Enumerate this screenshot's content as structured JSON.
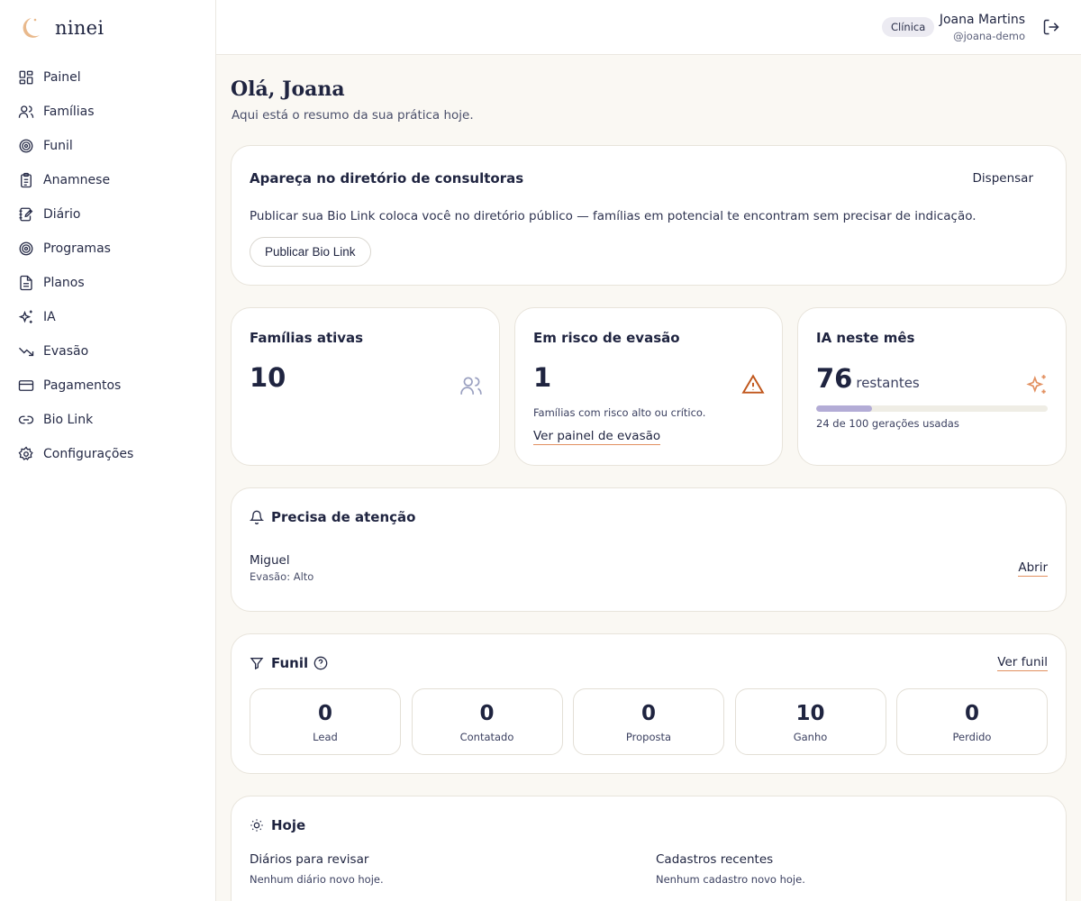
{
  "app": {
    "name": "ninei"
  },
  "sidebar": {
    "items": [
      {
        "label": "Painel",
        "icon": "dashboard-icon"
      },
      {
        "label": "Famílias",
        "icon": "users-icon"
      },
      {
        "label": "Funil",
        "icon": "target-icon"
      },
      {
        "label": "Anamnese",
        "icon": "clipboard-icon"
      },
      {
        "label": "Diário",
        "icon": "notebook-icon"
      },
      {
        "label": "Programas",
        "icon": "target-icon"
      },
      {
        "label": "Planos",
        "icon": "document-icon"
      },
      {
        "label": "IA",
        "icon": "sparkles-icon"
      },
      {
        "label": "Evasão",
        "icon": "trending-down-icon"
      },
      {
        "label": "Pagamentos",
        "icon": "credit-card-icon"
      },
      {
        "label": "Bio Link",
        "icon": "link-icon"
      },
      {
        "label": "Configurações",
        "icon": "gear-icon"
      }
    ]
  },
  "header": {
    "badge": "Clínica",
    "user_name": "Joana Martins",
    "user_handle": "@joana-demo"
  },
  "greeting": {
    "title": "Olá, Joana",
    "subtitle": "Aqui está o resumo da sua prática hoje."
  },
  "publish_card": {
    "title": "Apareça no diretório de consultoras",
    "dismiss": "Dispensar",
    "text": "Publicar sua Bio Link coloca você no diretório público — famílias em potencial te encontram sem precisar de indicação.",
    "button": "Publicar Bio Link"
  },
  "stats": {
    "active_families": {
      "title": "Famílias ativas",
      "value": "10"
    },
    "risk": {
      "title": "Em risco de evasão",
      "value": "1",
      "note": "Famílias com risco alto ou crítico.",
      "link": "Ver painel de evasão"
    },
    "ai": {
      "title": "IA neste mês",
      "value": "76",
      "value_suffix": "restantes",
      "used": 24,
      "total": 100,
      "usage_text": "24 de 100 gerações usadas"
    }
  },
  "attention": {
    "title": "Precisa de atenção",
    "items": [
      {
        "name": "Miguel",
        "detail": "Evasão: Alto",
        "action": "Abrir"
      }
    ]
  },
  "funnel": {
    "title": "Funil",
    "link": "Ver funil",
    "stages": [
      {
        "value": "0",
        "label": "Lead"
      },
      {
        "value": "0",
        "label": "Contatado"
      },
      {
        "value": "0",
        "label": "Proposta"
      },
      {
        "value": "10",
        "label": "Ganho"
      },
      {
        "value": "0",
        "label": "Perdido"
      }
    ]
  },
  "today": {
    "title": "Hoje",
    "diaries": {
      "title": "Diários para revisar",
      "text": "Nenhum diário novo hoje."
    },
    "signups": {
      "title": "Cadastros recentes",
      "text": "Nenhum cadastro novo hoje."
    }
  },
  "colors": {
    "accent": "#e29060",
    "warning": "#c0561b",
    "progress": "#b3acd6",
    "icon_muted": "#9aa0c0"
  }
}
